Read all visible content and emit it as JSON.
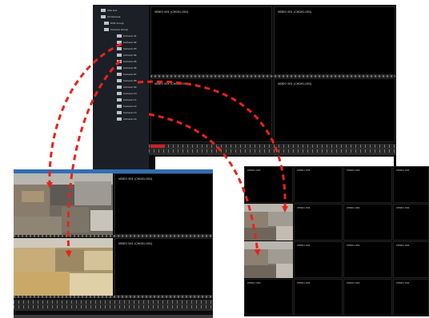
{
  "tree": {
    "items": [
      {
        "label": "Site List",
        "icon": "folder-icon"
      },
      {
        "label": "All Devices",
        "icon": "folder-icon"
      },
      {
        "label": "DVR Group",
        "icon": "folder-icon"
      },
      {
        "label": "Camera Group",
        "icon": "folder-icon"
      },
      {
        "label": "Camera 01",
        "icon": "camera-icon"
      },
      {
        "label": "Camera 02",
        "icon": "camera-icon"
      },
      {
        "label": "Camera 03",
        "icon": "camera-icon"
      },
      {
        "label": "Camera 04",
        "icon": "camera-icon"
      },
      {
        "label": "Camera 05",
        "icon": "camera-icon"
      },
      {
        "label": "Camera 06",
        "icon": "camera-icon"
      },
      {
        "label": "Camera 07",
        "icon": "camera-icon"
      },
      {
        "label": "Camera 08",
        "icon": "camera-icon"
      },
      {
        "label": "Camera 09",
        "icon": "camera-icon"
      },
      {
        "label": "Camera 10",
        "icon": "camera-icon"
      },
      {
        "label": "Camera 11",
        "icon": "camera-icon"
      },
      {
        "label": "Camera 12",
        "icon": "camera-icon"
      },
      {
        "label": "Camera 13",
        "icon": "camera-icon"
      },
      {
        "label": "Camera 14",
        "icon": "camera-icon"
      }
    ]
  },
  "back_window": {
    "captions": [
      "VIDEO 001 (CH001-001)",
      "VIDEO 001 (CH001-001)",
      "VIDEO 001 (CH001-001)",
      "VIDEO 001 (CH001-001)"
    ]
  },
  "left_window": {
    "captions": [
      "VIDEO 001 (CH001-001)",
      "VIDEO 001 (CH001-001)"
    ]
  },
  "right_window": {
    "caption": "CH001 001"
  },
  "colors": {
    "arrow": "#e8231a",
    "tree_bg": "#1c1f26",
    "pane_bg": "#000000",
    "titlebar": "#2f6fb4"
  }
}
